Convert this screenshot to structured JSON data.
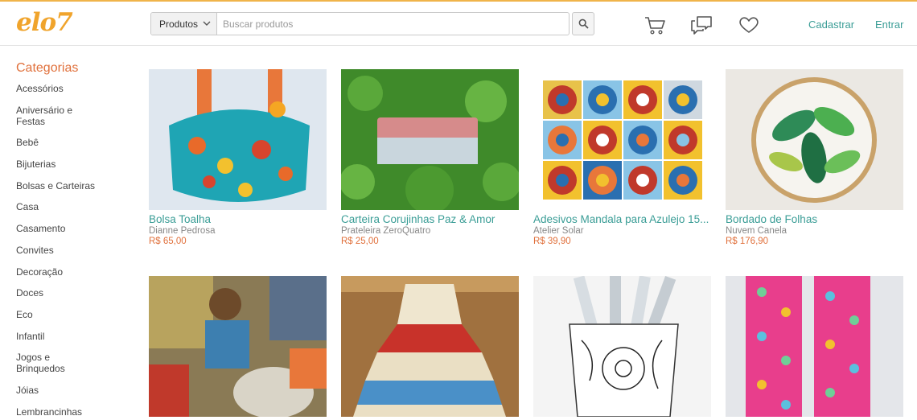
{
  "brand": {
    "logo": "elo7",
    "accent": "#f0a42c"
  },
  "search": {
    "category": "Produtos",
    "placeholder": "Buscar produtos"
  },
  "header": {
    "icons": [
      "cart-icon",
      "messages-icon",
      "heart-icon"
    ],
    "signup": "Cadastrar",
    "login": "Entrar"
  },
  "sidebar": {
    "title": "Categorias",
    "items": [
      {
        "label": "Acessórios"
      },
      {
        "label": "Aniversário e Festas"
      },
      {
        "label": "Bebê"
      },
      {
        "label": "Bijuterias"
      },
      {
        "label": "Bolsas e Carteiras"
      },
      {
        "label": "Casa"
      },
      {
        "label": "Casamento"
      },
      {
        "label": "Convites"
      },
      {
        "label": "Decoração"
      },
      {
        "label": "Doces"
      },
      {
        "label": "Eco"
      },
      {
        "label": "Infantil"
      },
      {
        "label": "Jogos e Brinquedos"
      },
      {
        "label": "Jóias"
      },
      {
        "label": "Lembrancinhas"
      }
    ]
  },
  "products": [
    {
      "name": "Bolsa Toalha",
      "seller": "Dianne Pedrosa",
      "price": "R$ 65,00"
    },
    {
      "name": "Carteira Corujinhas Paz & Amor",
      "seller": "Prateleira ZeroQuatro",
      "price": "R$ 25,00"
    },
    {
      "name": "Adesivos Mandala para Azulejo 15...",
      "seller": "Atelier Solar",
      "price": "R$ 39,90"
    },
    {
      "name": "Bordado de Folhas",
      "seller": "Nuvem Canela",
      "price": "R$ 176,90"
    },
    {
      "name": "",
      "seller": "",
      "price": ""
    },
    {
      "name": "",
      "seller": "",
      "price": ""
    },
    {
      "name": "",
      "seller": "",
      "price": ""
    },
    {
      "name": "",
      "seller": "",
      "price": ""
    }
  ]
}
